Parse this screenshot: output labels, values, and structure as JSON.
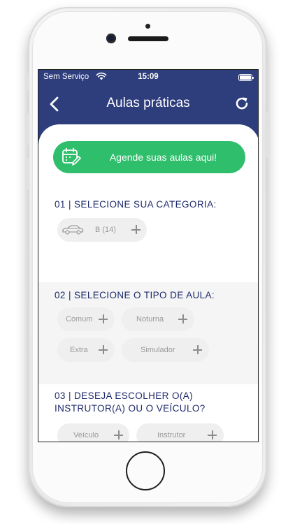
{
  "status_bar": {
    "carrier": "Sem Serviço",
    "time": "15:09",
    "wifi_icon": "wifi-icon",
    "battery_icon": "battery-icon"
  },
  "navbar": {
    "title": "Aulas práticas",
    "back_icon": "chevron-left-icon",
    "refresh_icon": "refresh-icon",
    "background_color": "#2e3d7c"
  },
  "cta": {
    "label": "Agende suas aulas aqui!",
    "icon": "calendar-edit-icon",
    "color": "#2fbe6c"
  },
  "sections": {
    "category": {
      "title": "01 | SELECIONE SUA CATEGORIA:",
      "options": [
        {
          "label": "B (14)",
          "icon": "car-icon"
        }
      ]
    },
    "lesson_type": {
      "title": "02 | SELECIONE O TIPO DE AULA:",
      "options": [
        {
          "label": "Comum"
        },
        {
          "label": "Noturna"
        },
        {
          "label": "Extra"
        },
        {
          "label": "Simulador"
        }
      ]
    },
    "choice": {
      "title": "03 | DESEJA ESCOLHER O(A) INSTRUTOR(A) OU O VEÍCULO?",
      "options": [
        {
          "label": "Veículo"
        },
        {
          "label": "Instrutor"
        }
      ]
    }
  },
  "colors": {
    "section_title": "#1d2a6b",
    "chip_background": "#efefef",
    "chip_text": "#9a9a9a"
  }
}
